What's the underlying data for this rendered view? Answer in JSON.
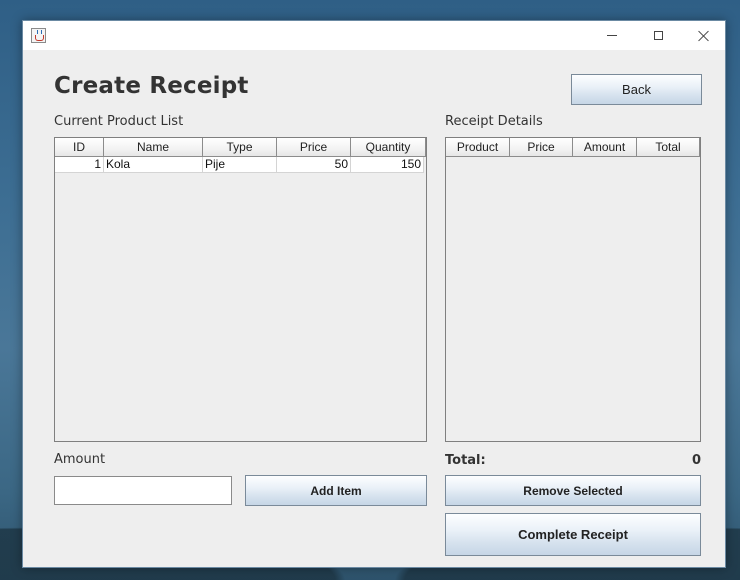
{
  "window": {
    "minimize_icon": "minimize-icon",
    "maximize_icon": "maximize-icon",
    "close_icon": "close-icon",
    "app_icon": "java-app-icon"
  },
  "header": {
    "title": "Create Receipt",
    "back_label": "Back"
  },
  "product_list": {
    "label": "Current Product List",
    "columns": [
      "ID",
      "Name",
      "Type",
      "Price",
      "Quantity"
    ],
    "rows": [
      [
        "1",
        "Kola",
        "Pije",
        "50",
        "150"
      ]
    ]
  },
  "receipt_details": {
    "label": "Receipt Details",
    "columns": [
      "Product",
      "Price",
      "Amount",
      "Total"
    ],
    "rows": []
  },
  "amount": {
    "label": "Amount",
    "value": "",
    "add_label": "Add Item"
  },
  "totals": {
    "label": "Total:",
    "value": "0"
  },
  "actions": {
    "remove_label": "Remove Selected",
    "complete_label": "Complete Receipt"
  }
}
